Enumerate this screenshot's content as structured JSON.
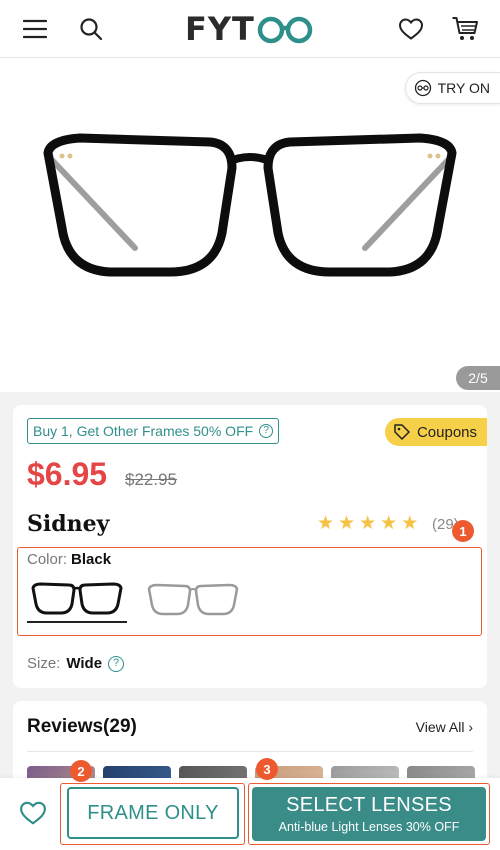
{
  "header": {
    "logo_text": "FYT",
    "logo_accent": "#2f8f8a"
  },
  "gallery": {
    "try_on_label": "TRY ON",
    "counter": "2/5"
  },
  "product": {
    "promo_label": "Buy 1, Get Other Frames 50% OFF",
    "coupons_label": "Coupons",
    "price": "$6.95",
    "original_price": "$22.95",
    "name": "Sidney",
    "rating_count": "(29)",
    "color_label": "Color:",
    "color_value": "Black",
    "size_label": "Size:",
    "size_value": "Wide"
  },
  "reviews": {
    "title": "Reviews(29)",
    "view_all": "View All"
  },
  "bottom_bar": {
    "frame_only": "FRAME ONLY",
    "select_lenses": "SELECT LENSES",
    "select_lenses_sub": "Anti-blue Light Lenses 30% OFF"
  },
  "annotations": {
    "badge_1": "1",
    "badge_2": "2",
    "badge_3": "3"
  },
  "colors": {
    "price": "#e54545",
    "teal": "#2f8f8a",
    "coupon": "#f7d04a",
    "highlight": "#ee5a2f"
  }
}
